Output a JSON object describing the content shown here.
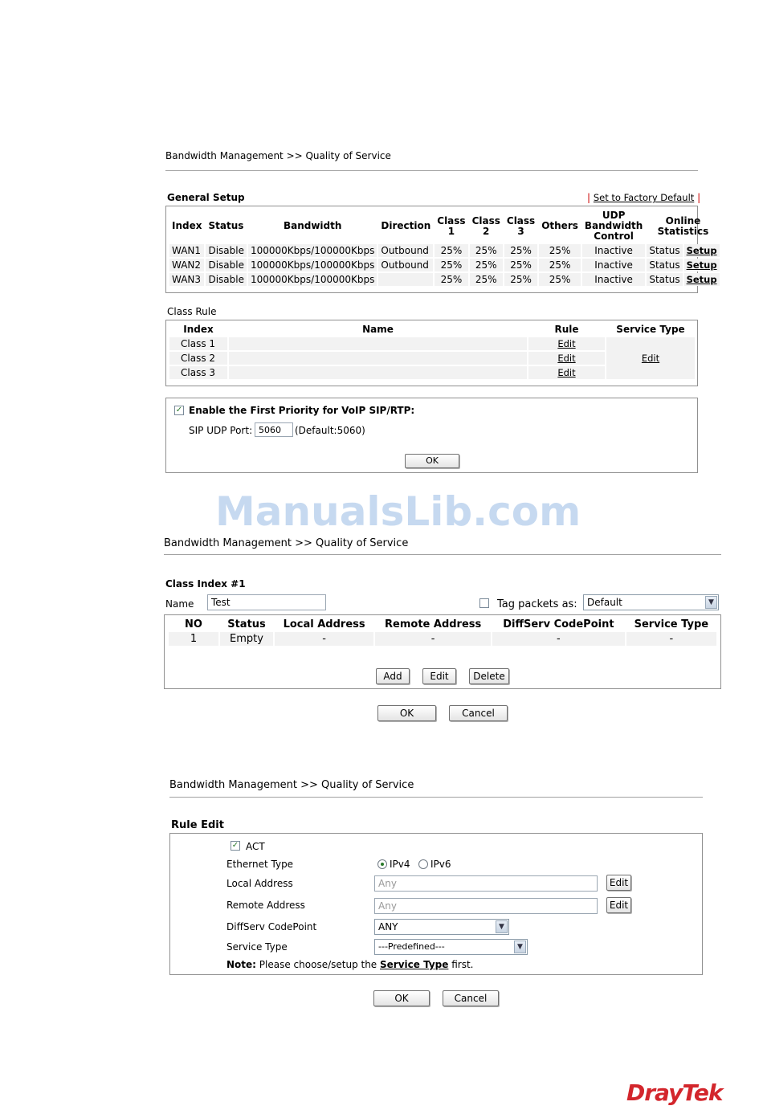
{
  "screen1": {
    "breadcrumb": "Bandwidth Management >> Quality of Service",
    "general_setup": {
      "title": "General Setup",
      "factory_default": "Set to Factory Default",
      "headers": {
        "index": "Index",
        "status": "Status",
        "bandwidth": "Bandwidth",
        "direction": "Direction",
        "class1": "Class 1",
        "class2": "Class 2",
        "class3": "Class 3",
        "others": "Others",
        "udp": "UDP Bandwidth Control",
        "online": "Online Statistics"
      },
      "rows": [
        {
          "index": "WAN1",
          "status": "Disable",
          "bandwidth": "100000Kbps/100000Kbps",
          "direction": "Outbound",
          "c1": "25%",
          "c2": "25%",
          "c3": "25%",
          "others": "25%",
          "udp": "Inactive",
          "online": "Status",
          "setup": "Setup"
        },
        {
          "index": "WAN2",
          "status": "Disable",
          "bandwidth": "100000Kbps/100000Kbps",
          "direction": "Outbound",
          "c1": "25%",
          "c2": "25%",
          "c3": "25%",
          "others": "25%",
          "udp": "Inactive",
          "online": "Status",
          "setup": "Setup"
        },
        {
          "index": "WAN3",
          "status": "Disable",
          "bandwidth": "100000Kbps/100000Kbps",
          "direction": "",
          "c1": "25%",
          "c2": "25%",
          "c3": "25%",
          "others": "25%",
          "udp": "Inactive",
          "online": "Status",
          "setup": "Setup"
        }
      ]
    },
    "class_rule": {
      "title": "Class Rule",
      "headers": {
        "index": "Index",
        "name": "Name",
        "rule": "Rule",
        "service_type": "Service Type"
      },
      "rows": [
        {
          "index": "Class 1",
          "name": "",
          "rule": "Edit"
        },
        {
          "index": "Class 2",
          "name": "",
          "rule": "Edit"
        },
        {
          "index": "Class 3",
          "name": "",
          "rule": "Edit"
        }
      ],
      "service_type_edit": "Edit"
    },
    "voip": {
      "enable_label": "Enable the First Priority for VoIP SIP/RTP:",
      "enabled": true,
      "sip_port_label": "SIP UDP Port:",
      "sip_port_value": "5060",
      "sip_port_default": "(Default:5060)",
      "ok": "OK"
    }
  },
  "watermark": "ManualsLib.com",
  "screen2": {
    "breadcrumb": "Bandwidth Management >> Quality of Service",
    "class_index": "Class Index #1",
    "name_label": "Name",
    "name_value": "Test",
    "tag_label": "Tag packets as:",
    "tag_checked": false,
    "tag_value": "Default",
    "headers": {
      "no": "NO",
      "status": "Status",
      "local": "Local Address",
      "remote": "Remote Address",
      "diffserv": "DiffServ CodePoint",
      "service": "Service Type"
    },
    "rows": [
      {
        "no": "1",
        "status": "Empty",
        "local": "-",
        "remote": "-",
        "diffserv": "-",
        "service": "-"
      }
    ],
    "add": "Add",
    "edit": "Edit",
    "delete": "Delete",
    "ok": "OK",
    "cancel": "Cancel"
  },
  "screen3": {
    "breadcrumb": "Bandwidth Management >> Quality of Service",
    "title": "Rule Edit",
    "act_label": "ACT",
    "act_checked": true,
    "ethernet_type_label": "Ethernet Type",
    "ipv4": "IPv4",
    "ipv6": "IPv6",
    "ethernet_selected": "IPv4",
    "local_label": "Local Address",
    "local_placeholder": "Any",
    "remote_label": "Remote Address",
    "remote_placeholder": "Any",
    "edit": "Edit",
    "diffserv_label": "DiffServ CodePoint",
    "diffserv_value": "ANY",
    "service_label": "Service Type",
    "service_value": "---Predefined---",
    "note_prefix": "Note:",
    "note_text": "Please choose/setup the",
    "note_link": "Service Type",
    "note_suffix": "first.",
    "ok": "OK",
    "cancel": "Cancel"
  },
  "logo": "DrayTek"
}
